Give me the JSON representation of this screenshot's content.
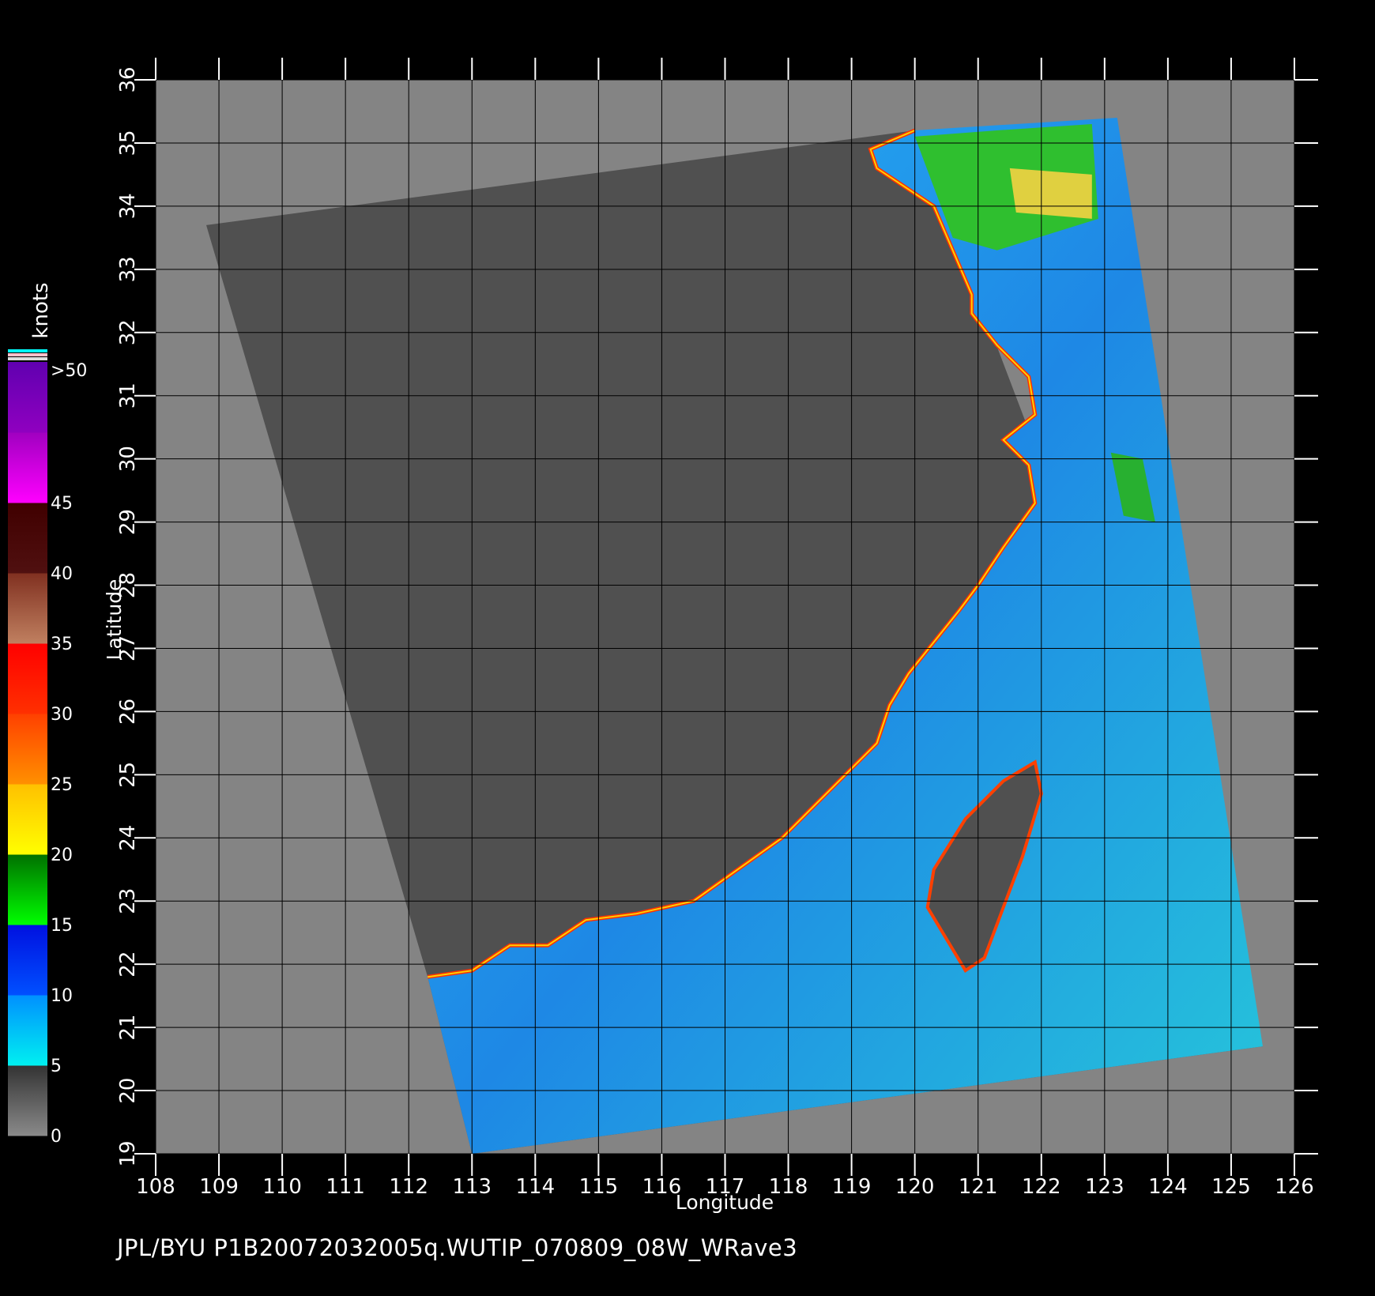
{
  "map": {
    "lon_min": 108,
    "lon_max": 126,
    "lat_min": 19,
    "lat_max": 36,
    "lon_ticks": [
      "108",
      "109",
      "110",
      "111",
      "112",
      "113",
      "114",
      "115",
      "116",
      "117",
      "118",
      "119",
      "120",
      "121",
      "122",
      "123",
      "124",
      "125",
      "126"
    ],
    "lat_ticks": [
      "19",
      "20",
      "21",
      "22",
      "23",
      "24",
      "25",
      "26",
      "27",
      "28",
      "29",
      "30",
      "31",
      "32",
      "33",
      "34",
      "35",
      "36"
    ],
    "xlabel": "Longitude",
    "ylabel": "Latitude",
    "swath_corners": [
      [
        108.8,
        33.7
      ],
      [
        120.0,
        35.2
      ],
      [
        125.5,
        20.7
      ],
      [
        113.0,
        19.0
      ],
      [
        112.3,
        21.8
      ]
    ]
  },
  "colorbar": {
    "unit": "knots",
    "labels": [
      "0",
      "5",
      "10",
      "15",
      "20",
      "25",
      "30",
      "35",
      "40",
      "45",
      ">50"
    ],
    "bands": [
      {
        "from": "#8a8a8a",
        "to": "#333333"
      },
      {
        "from": "#00f0f0",
        "to": "#0090ff"
      },
      {
        "from": "#0050ff",
        "to": "#0010e0"
      },
      {
        "from": "#00ff00",
        "to": "#007000"
      },
      {
        "from": "#ffff00",
        "to": "#ffc000"
      },
      {
        "from": "#ff9000",
        "to": "#ff4000"
      },
      {
        "from": "#ff3000",
        "to": "#ff0000"
      },
      {
        "from": "#c08060",
        "to": "#803020"
      },
      {
        "from": "#501010",
        "to": "#400000"
      },
      {
        "from": "#ff00ff",
        "to": "#a000c0"
      },
      {
        "from": "#9000c0",
        "to": "#6000b0"
      }
    ]
  },
  "colors": {
    "background": "#000000",
    "outside": "#848484",
    "land": "#505050",
    "grid": "#000000"
  },
  "footer": "JPL/BYU  P1B20072032005q.WUTIP_070809_08W_WRave3"
}
